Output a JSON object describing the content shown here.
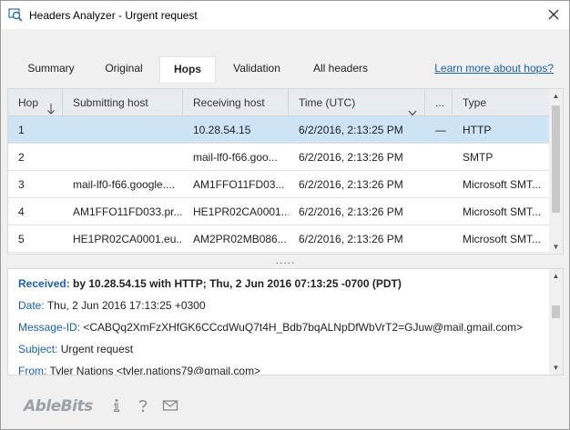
{
  "window": {
    "title": "Headers Analyzer - Urgent request"
  },
  "tabs": [
    {
      "label": "Summary",
      "active": false
    },
    {
      "label": "Original",
      "active": false
    },
    {
      "label": "Hops",
      "active": true
    },
    {
      "label": "Validation",
      "active": false
    },
    {
      "label": "All headers",
      "active": false
    }
  ],
  "learn_link": "Learn more about hops?",
  "grid": {
    "columns": [
      "Hop",
      "Submitting host",
      "Receiving host",
      "Time (UTC)",
      "...",
      "Type"
    ],
    "rows": [
      {
        "hop": "1",
        "submitting": "",
        "receiving": "10.28.54.15",
        "time": "6/2/2016, 2:13:25 PM",
        "delay": "—",
        "type": "HTTP",
        "selected": true
      },
      {
        "hop": "2",
        "submitting": "",
        "receiving": "mail-lf0-f66.goo...",
        "time": "6/2/2016, 2:13:26 PM",
        "delay": "",
        "type": "SMTP",
        "selected": false
      },
      {
        "hop": "3",
        "submitting": "mail-lf0-f66.google....",
        "receiving": "AM1FFO11FD03...",
        "time": "6/2/2016, 2:13:26 PM",
        "delay": "",
        "type": "Microsoft SMT...",
        "selected": false
      },
      {
        "hop": "4",
        "submitting": "AM1FFO11FD033.pr...",
        "receiving": "HE1PR02CA0001...",
        "time": "6/2/2016, 2:13:26 PM",
        "delay": "",
        "type": "Microsoft SMT...",
        "selected": false
      },
      {
        "hop": "5",
        "submitting": "HE1PR02CA0001.eu...",
        "receiving": "AM2PR02MB086...",
        "time": "6/2/2016, 2:13:26 PM",
        "delay": "",
        "type": "Microsoft SMT...",
        "selected": false
      }
    ]
  },
  "splitter": ".....",
  "details": {
    "received_label": "Received:",
    "received_value": "by 10.28.54.15 with HTTP; Thu, 2 Jun 2016 07:13:25 -0700 (PDT)",
    "date_label": "Date:",
    "date_value": "Thu, 2 Jun 2016 17:13:25 +0300",
    "messageid_label": "Message-ID:",
    "messageid_value": "<CABQq2XmFzXHfGK6CCcdWuQ7t4H_Bdb7bqALNpDfWbVrT2=GJuw@mail.gmail.com>",
    "subject_label": "Subject:",
    "subject_value": "Urgent request",
    "from_label": "From:",
    "from_value": "Tyler Nations <tyler.nations79@gmail.com>"
  },
  "footer": {
    "logo": "AbleBits"
  },
  "colors": {
    "accent": "#1a5fb4",
    "selection": "#cde4f7",
    "header_bg": "#e8ecf0"
  },
  "icons": [
    "headers-analyzer-icon",
    "close-icon",
    "sort-down-icon",
    "dropdown-icon",
    "info-icon",
    "help-icon",
    "mail-icon"
  ]
}
